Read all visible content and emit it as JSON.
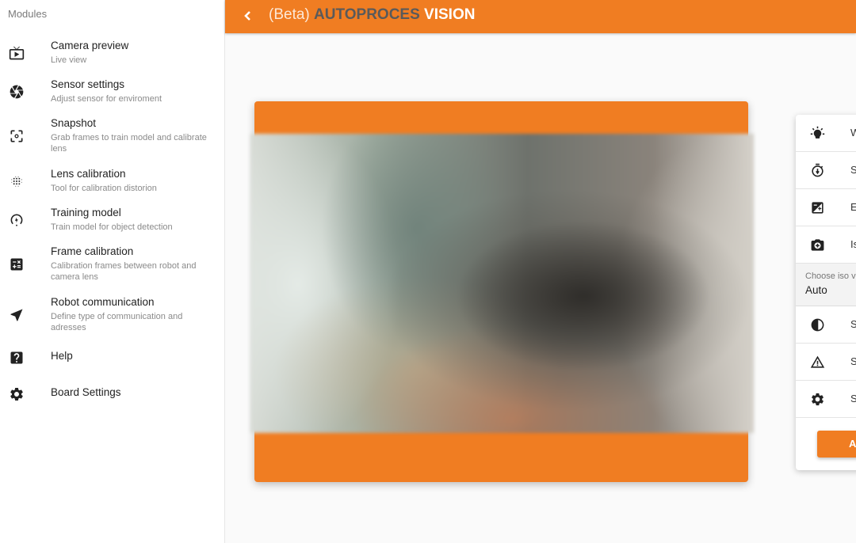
{
  "sidebar": {
    "title": "Modules",
    "items": [
      {
        "label": "Camera preview",
        "sub": "Live view",
        "icon": "live-tv-icon"
      },
      {
        "label": "Sensor settings",
        "sub": "Adjust sensor for enviroment",
        "icon": "camera-shutter-icon"
      },
      {
        "label": "Snapshot",
        "sub": "Grab frames to train model and calibrate lens",
        "icon": "center-focus-icon"
      },
      {
        "label": "Lens calibration",
        "sub": "Tool for calibration distorion",
        "icon": "grain-grid-icon"
      },
      {
        "label": "Training model",
        "sub": "Train model for object detection",
        "icon": "model-training-icon"
      },
      {
        "label": "Frame calibration",
        "sub": "Calibration frames between robot and camera lens",
        "icon": "calculator-icon"
      },
      {
        "label": "Robot communication",
        "sub": "Define type of communication and adresses",
        "icon": "navigation-arrow-icon"
      },
      {
        "label": "Help",
        "sub": "",
        "icon": "help-icon"
      },
      {
        "label": "Board Settings",
        "sub": "",
        "icon": "gear-icon"
      }
    ]
  },
  "header": {
    "title_prefix": "(Beta)",
    "title_part1": "AUTOPROCES",
    "title_part2": "VISION",
    "accent_color": "#f07d22"
  },
  "settings_panel": {
    "rows": [
      {
        "label": "W",
        "icon": "white-balance-icon"
      },
      {
        "label": "S",
        "icon": "shutter-timer-icon"
      },
      {
        "label": "E",
        "icon": "exposure-icon"
      },
      {
        "label": "Is",
        "icon": "camera-iso-icon"
      }
    ],
    "iso_caption": "Choose iso v",
    "iso_value": "Auto",
    "rows_after": [
      {
        "label": "S",
        "icon": "contrast-icon"
      },
      {
        "label": "S",
        "icon": "warning-triangle-icon"
      },
      {
        "label": "S",
        "icon": "gear-icon"
      }
    ],
    "apply_label": "A"
  }
}
